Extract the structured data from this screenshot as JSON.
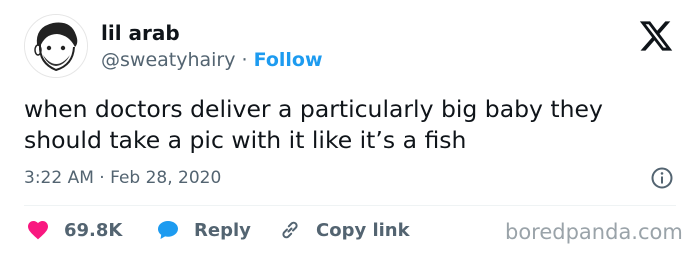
{
  "author": {
    "display_name": "lil arab",
    "handle": "@sweatyhairy",
    "separator": "·",
    "follow_label": "Follow",
    "avatar_icon": "cartoon-avatar-icon"
  },
  "platform": {
    "logo_icon": "x-logo-icon"
  },
  "tweet": {
    "text": "when doctors deliver a particularly big baby they should take a pic with it like it’s a fish"
  },
  "meta": {
    "time": "3:22 AM",
    "separator": "·",
    "date": "Feb 28, 2020",
    "info_icon": "info-icon"
  },
  "actions": {
    "like_count": "69.8K",
    "reply_label": "Reply",
    "copy_link_label": "Copy link"
  },
  "watermark": {
    "text": "boredpanda.com"
  },
  "colors": {
    "follow": "#1d9bf0",
    "like": "#f91880",
    "reply": "#1d9bf0",
    "secondary_text": "#536471",
    "primary_text": "#0f1419",
    "watermark": "#9aa3a9"
  }
}
